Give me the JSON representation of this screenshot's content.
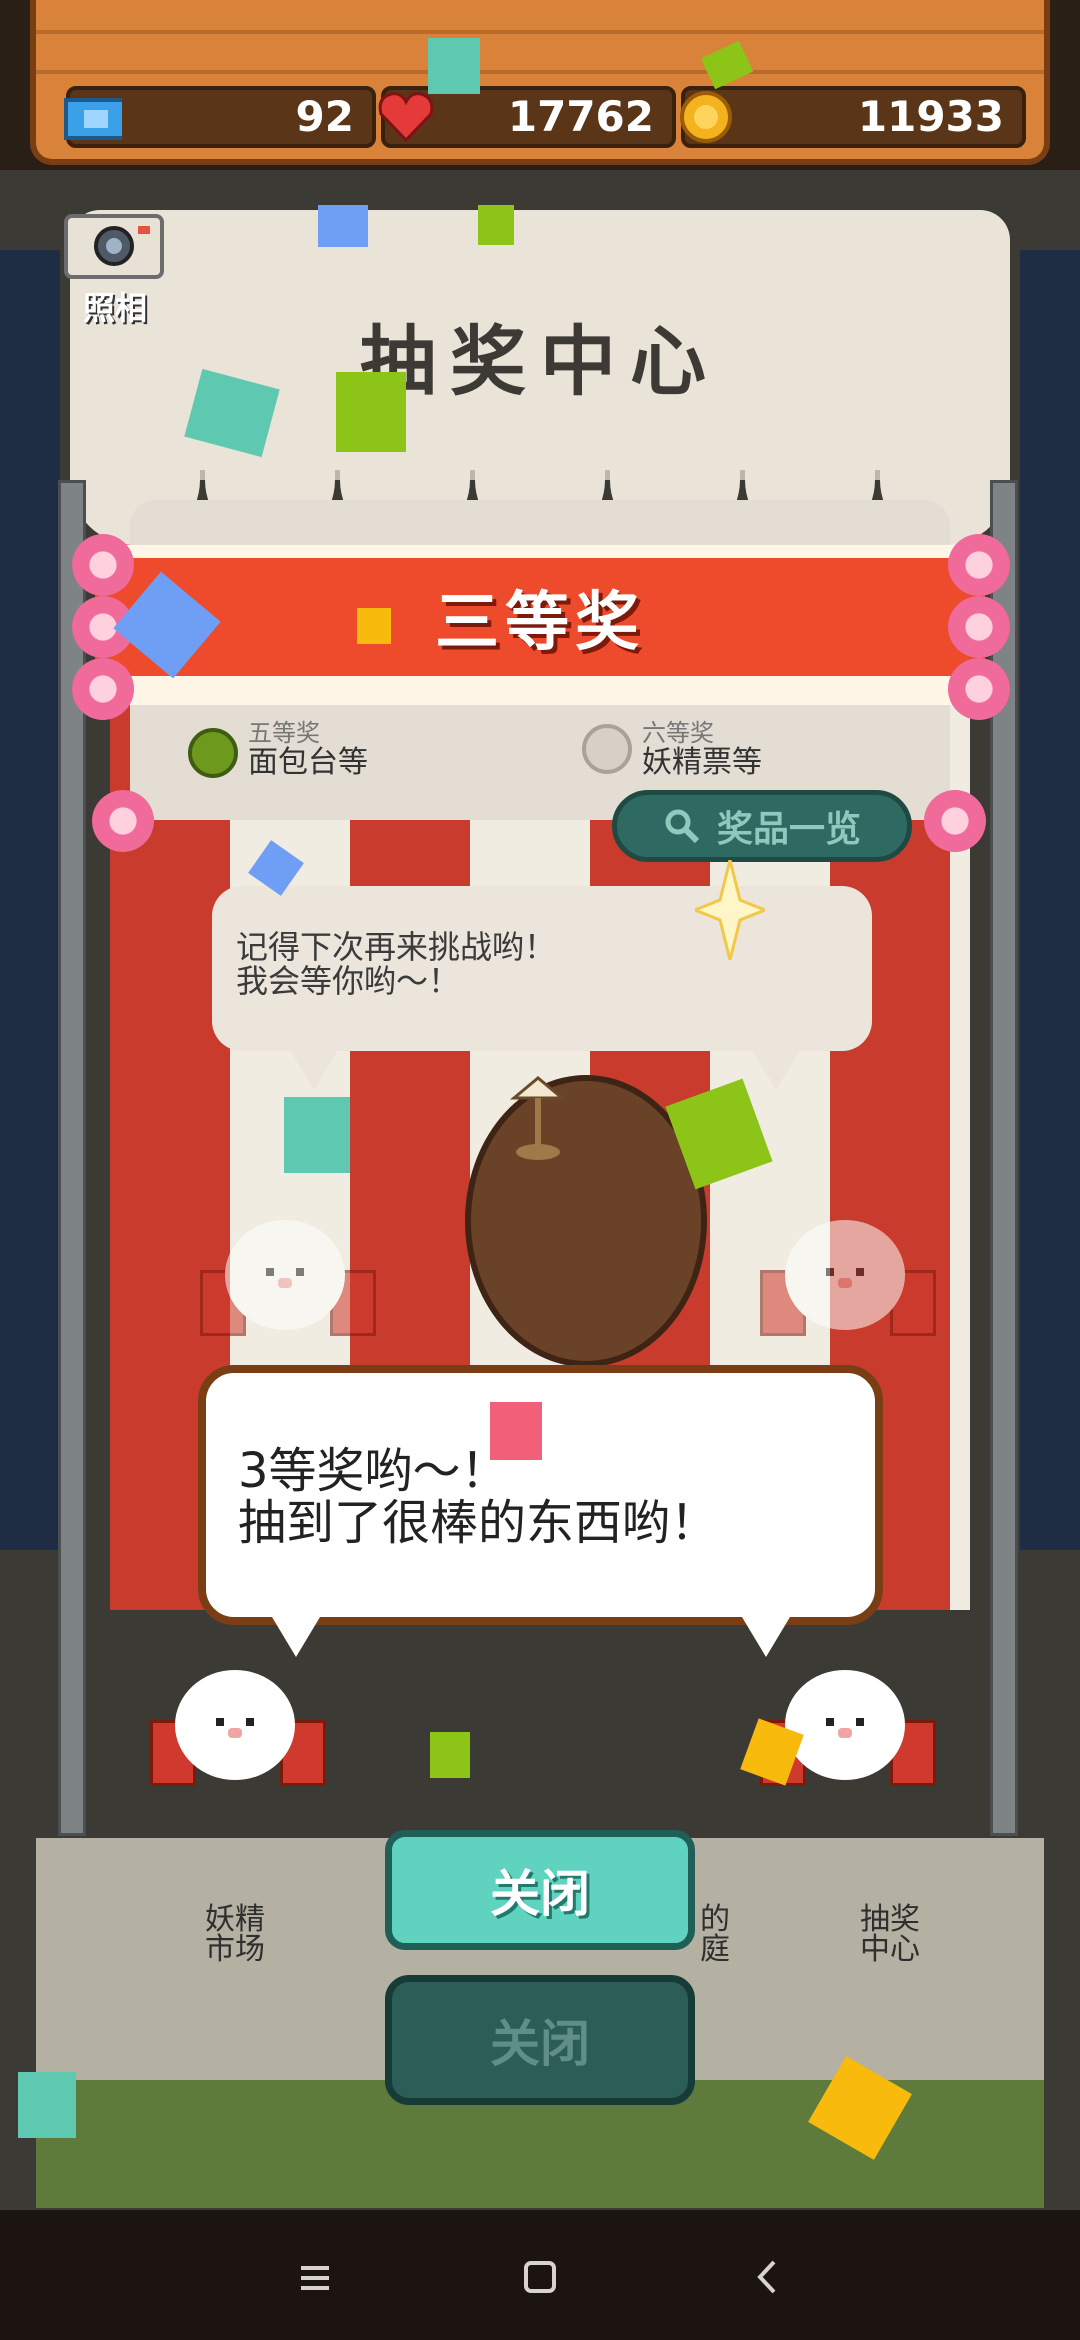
{
  "top_bar": {
    "tickets": "92",
    "hearts": "17762",
    "coins": "11933"
  },
  "camera": {
    "label": "照相"
  },
  "booth": {
    "title": "抽奖中心",
    "result_banner": "三等奖",
    "prize_left_rank": "五等奖",
    "prize_left_item": "面包台等",
    "prize_right_rank": "六等奖",
    "prize_right_item": "妖精票等",
    "prize_list_button": "奖品一览",
    "hint_line1": "记得下次再来挑战哟！",
    "hint_line2": "我会等你哟～！"
  },
  "dialog": {
    "line1": "3等奖哟～！",
    "line2": "抽到了很棒的东西哟！"
  },
  "buttons": {
    "close": "关闭",
    "close_ghost": "关闭"
  },
  "places": {
    "market_line1": "妖精",
    "market_line2": "市场",
    "yard_line1": "的",
    "yard_line2": "庭",
    "lottery_line1": "抽奖",
    "lottery_line2": "中心"
  },
  "colors": {
    "banner_red": "#ee4a2c",
    "button_teal": "#5fd3c0",
    "wood": "#d9823a"
  },
  "icons": [
    "ticket-icon",
    "heart-icon",
    "coin-icon",
    "camera-icon",
    "search-icon",
    "menu-icon",
    "home-icon",
    "back-icon"
  ]
}
